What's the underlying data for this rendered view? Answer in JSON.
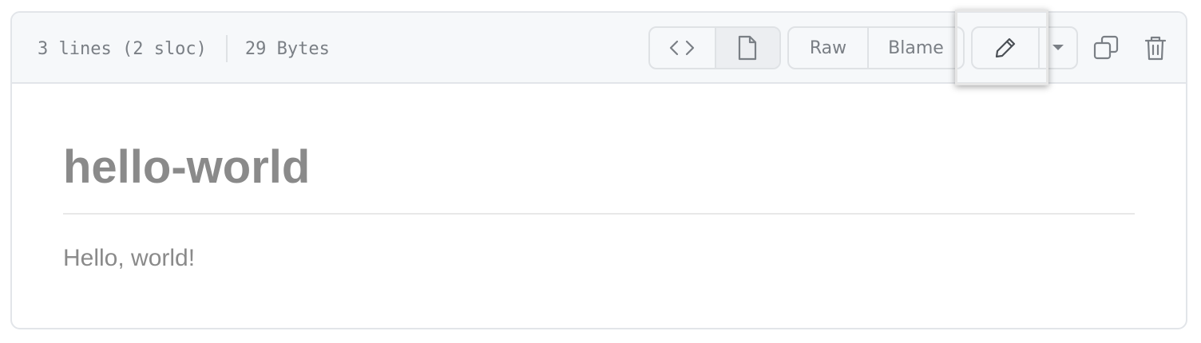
{
  "file_header": {
    "lines_info": "3 lines (2 sloc)",
    "size_info": "29 Bytes"
  },
  "toolbar": {
    "code_view_icon": "code-icon",
    "preview_icon": "file-icon",
    "raw_label": "Raw",
    "blame_label": "Blame",
    "edit_icon": "pencil-icon",
    "more_icon": "triangle-down-icon",
    "copy_icon": "copy-icon",
    "delete_icon": "trash-icon"
  },
  "content": {
    "heading": "hello-world",
    "paragraph": "Hello, world!"
  },
  "colors": {
    "header_bg": "#f6f8fa",
    "border": "#e2e5e9",
    "text_muted": "#7a7f85",
    "content_text": "#8a8a8a"
  }
}
